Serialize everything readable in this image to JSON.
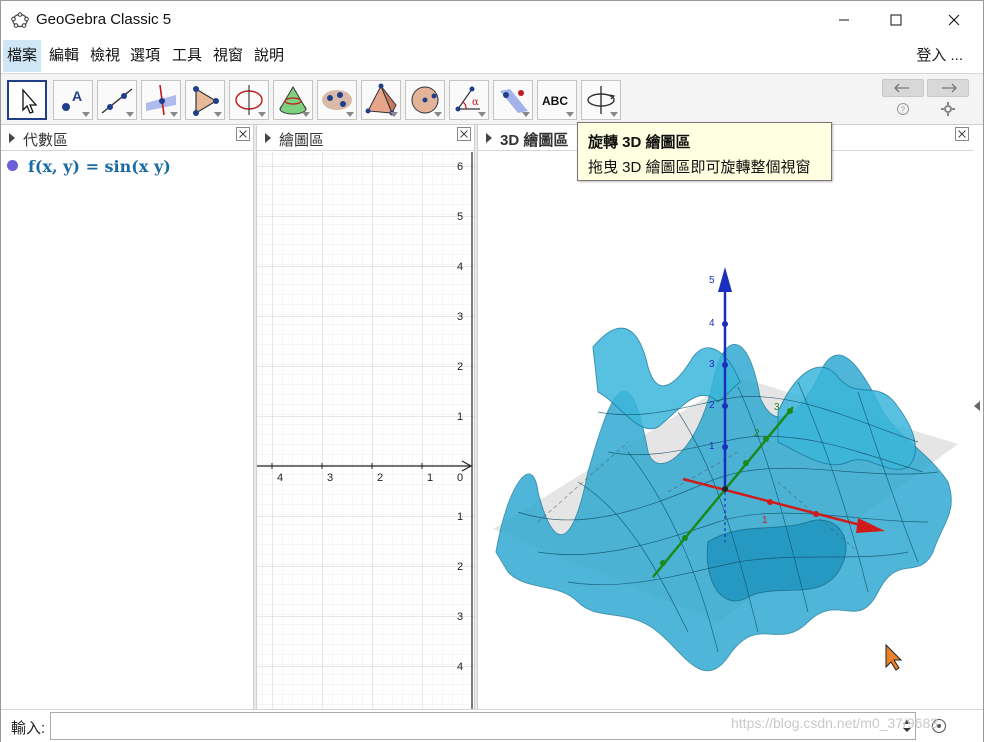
{
  "window": {
    "title": "GeoGebra Classic 5"
  },
  "menu": {
    "items": [
      "檔案",
      "編輯",
      "檢視",
      "選項",
      "工具",
      "視窗",
      "說明"
    ],
    "login": "登入 ..."
  },
  "toolbar": {
    "tools": [
      {
        "name": "move-tool-icon"
      },
      {
        "name": "point-tool-icon",
        "label": "A"
      },
      {
        "name": "line-tool-icon"
      },
      {
        "name": "perpendicular-tool-icon"
      },
      {
        "name": "polygon-tool-icon"
      },
      {
        "name": "circle-tool-icon"
      },
      {
        "name": "intersect-surfaces-tool-icon"
      },
      {
        "name": "plane-tool-icon"
      },
      {
        "name": "pyramid-tool-icon"
      },
      {
        "name": "sphere-tool-icon"
      },
      {
        "name": "angle-tool-icon",
        "label": "α"
      },
      {
        "name": "reflect-tool-icon"
      },
      {
        "name": "text-tool-icon",
        "label": "ABC"
      },
      {
        "name": "rotate-3d-view-tool-icon"
      }
    ]
  },
  "panels": {
    "algebra": {
      "title": "代數區",
      "entry": "f(x, y) = sin(x y)"
    },
    "graphics": {
      "title": "繪圖區"
    },
    "graphics3d": {
      "title": "3D 繪圖區"
    }
  },
  "graphics_axes": {
    "x_ticks": [
      "4",
      "3",
      "2",
      "1",
      "0"
    ],
    "y_ticks_pos": [
      "6",
      "5",
      "4",
      "3",
      "2",
      "1"
    ],
    "y_ticks_neg": [
      "1",
      "2",
      "3",
      "4"
    ]
  },
  "axes3d": {
    "z_ticks": [
      "5",
      "4",
      "3",
      "2",
      "1"
    ],
    "y_ticks": [
      "3",
      "2"
    ],
    "x_ticks": [
      "1"
    ]
  },
  "tooltip": {
    "title": "旋轉 3D 繪圖區",
    "body": "拖曳 3D 繪圖區即可旋轉整個視窗"
  },
  "inputbar": {
    "label": "輸入:",
    "value": ""
  },
  "watermark": "https://blog.csdn.net/m0_37/9683",
  "colors": {
    "accent": "#1f3f8a",
    "surface": "#2aa7d1",
    "x_axis": "#d11b1b",
    "y_axis": "#1a8a1a",
    "z_axis": "#1b2fbd",
    "algebra_text": "#1a6aa3",
    "function_dot": "#6a5fd8"
  }
}
